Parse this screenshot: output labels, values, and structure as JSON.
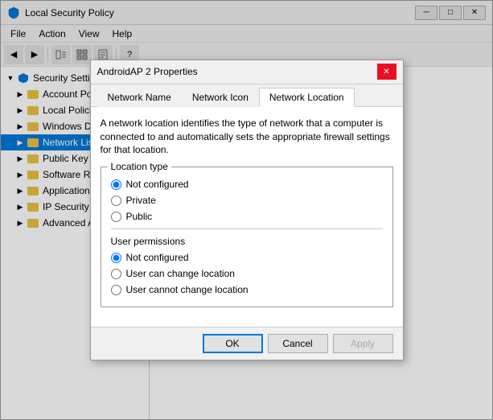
{
  "window": {
    "title": "Local Security Policy",
    "icon": "shield"
  },
  "menu": {
    "items": [
      "File",
      "Action",
      "View",
      "Help"
    ]
  },
  "toolbar": {
    "buttons": [
      "back",
      "forward",
      "up",
      "show-hide-tree",
      "properties"
    ]
  },
  "sidebar": {
    "items": [
      {
        "id": "security-settings",
        "label": "Security Settings",
        "level": 0,
        "expanded": true,
        "icon": "shield"
      },
      {
        "id": "account-policies",
        "label": "Account Policies",
        "level": 1,
        "expanded": false,
        "icon": "folder"
      },
      {
        "id": "local-policies",
        "label": "Local Policies",
        "level": 1,
        "expanded": false,
        "icon": "folder"
      },
      {
        "id": "windows-defender",
        "label": "Windows Defender Firewall",
        "level": 1,
        "expanded": false,
        "icon": "folder"
      },
      {
        "id": "network-list",
        "label": "Network List Manager Polici...",
        "level": 1,
        "expanded": false,
        "icon": "folder",
        "selected": true
      },
      {
        "id": "public-key",
        "label": "Public Key Policies",
        "level": 1,
        "expanded": false,
        "icon": "folder"
      },
      {
        "id": "software-restriction",
        "label": "Software Restriction Policies",
        "level": 1,
        "expanded": false,
        "icon": "folder"
      },
      {
        "id": "application-control",
        "label": "Application Control Policies",
        "level": 1,
        "expanded": false,
        "icon": "folder"
      },
      {
        "id": "ip-security",
        "label": "IP Security Policies on Local...",
        "level": 1,
        "expanded": false,
        "icon": "folder"
      },
      {
        "id": "advanced-audit",
        "label": "Advanced Audit Policy Cont...",
        "level": 1,
        "expanded": false,
        "icon": "folder"
      }
    ]
  },
  "dialog": {
    "title": "AndroidAP  2 Properties",
    "tabs": [
      {
        "id": "network-name",
        "label": "Network Name"
      },
      {
        "id": "network-icon",
        "label": "Network Icon"
      },
      {
        "id": "network-location",
        "label": "Network Location",
        "active": true
      }
    ],
    "network_location_tab": {
      "description": "A network location identifies the type of network that a computer is connected to and automatically sets the appropriate firewall settings for that location.",
      "location_type_group": {
        "title": "Location type",
        "options": [
          {
            "id": "loc-not-configured",
            "label": "Not configured",
            "checked": true
          },
          {
            "id": "loc-private",
            "label": "Private",
            "checked": false
          },
          {
            "id": "loc-public",
            "label": "Public",
            "checked": false
          }
        ]
      },
      "user_permissions_group": {
        "title": "User permissions",
        "options": [
          {
            "id": "perm-not-configured",
            "label": "Not configured",
            "checked": true
          },
          {
            "id": "perm-can-change",
            "label": "User can change location",
            "checked": false
          },
          {
            "id": "perm-cannot-change",
            "label": "User cannot change location",
            "checked": false
          }
        ]
      }
    },
    "footer": {
      "ok_label": "OK",
      "cancel_label": "Cancel",
      "apply_label": "Apply"
    }
  }
}
